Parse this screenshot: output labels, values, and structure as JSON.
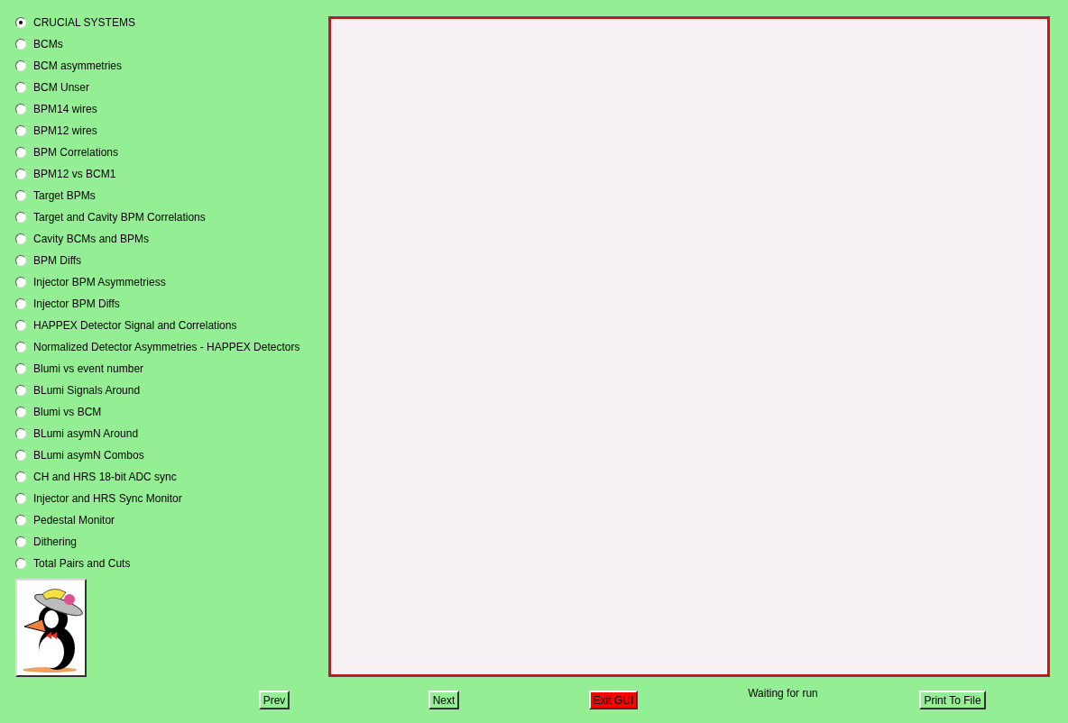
{
  "options": [
    {
      "label": "CRUCIAL SYSTEMS",
      "selected": true
    },
    {
      "label": "BCMs",
      "selected": false
    },
    {
      "label": "BCM asymmetries",
      "selected": false
    },
    {
      "label": "BCM Unser",
      "selected": false
    },
    {
      "label": "BPM14 wires",
      "selected": false
    },
    {
      "label": "BPM12 wires",
      "selected": false
    },
    {
      "label": "BPM Correlations",
      "selected": false
    },
    {
      "label": "BPM12 vs BCM1",
      "selected": false
    },
    {
      "label": "Target BPMs",
      "selected": false
    },
    {
      "label": "Target and Cavity BPM Correlations",
      "selected": false
    },
    {
      "label": "Cavity BCMs and BPMs",
      "selected": false
    },
    {
      "label": "BPM Diffs",
      "selected": false
    },
    {
      "label": "Injector BPM Asymmetriess",
      "selected": false
    },
    {
      "label": "Injector BPM Diffs",
      "selected": false
    },
    {
      "label": "HAPPEX Detector Signal and Correlations",
      "selected": false
    },
    {
      "label": "Normalized Detector Asymmetries - HAPPEX Detectors",
      "selected": false
    },
    {
      "label": "Blumi vs event number",
      "selected": false
    },
    {
      "label": "BLumi Signals Around",
      "selected": false
    },
    {
      "label": "Blumi vs BCM",
      "selected": false
    },
    {
      "label": "BLumi asymN Around",
      "selected": false
    },
    {
      "label": "BLumi asymN Combos",
      "selected": false
    },
    {
      "label": "CH and HRS 18-bit ADC sync",
      "selected": false
    },
    {
      "label": "Injector and HRS Sync Monitor",
      "selected": false
    },
    {
      "label": "Pedestal Monitor",
      "selected": false
    },
    {
      "label": "Dithering",
      "selected": false
    },
    {
      "label": "Total Pairs and Cuts",
      "selected": false
    }
  ],
  "footer": [
    {
      "kind": "button",
      "text": "Prev"
    },
    {
      "kind": "button",
      "text": "Next"
    },
    {
      "kind": "exit",
      "text": "Exit GUI"
    },
    {
      "kind": "status",
      "text": "Waiting for run"
    },
    {
      "kind": "button",
      "text": "Print To File"
    }
  ]
}
